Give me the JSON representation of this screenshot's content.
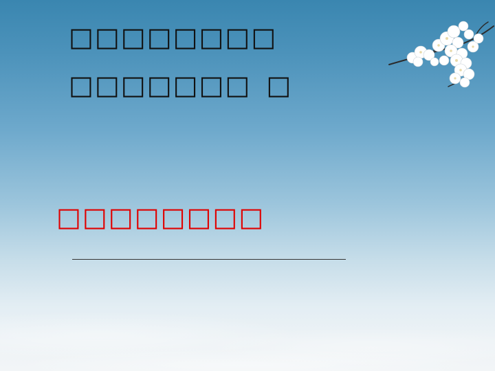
{
  "slide": {
    "title_line_1": "□□□□□□□□",
    "title_line_2_main": "□□□□□□□",
    "title_line_2_tail": "□",
    "subtitle": "□□□□□□□□",
    "colors": {
      "title": "#111111",
      "subtitle": "#e00000",
      "sky_top": "#3a86b0",
      "sky_bottom": "#f2f5f7"
    },
    "decoration": "cherry-blossom-branch"
  }
}
